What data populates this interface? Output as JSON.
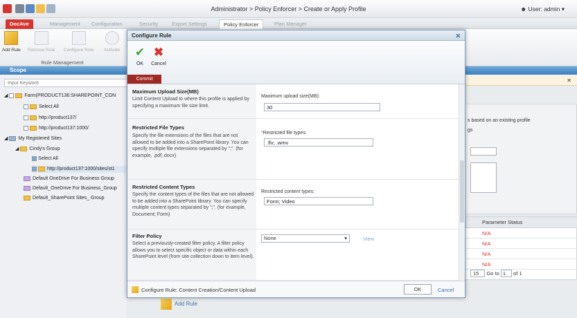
{
  "title_bar": {
    "breadcrumb": "Administrator > Policy Enforcer > Create or Apply Profile",
    "user": "User: admin"
  },
  "tabs": [
    "DocAve",
    "Management",
    "Configuration",
    "Security",
    "Export Settings",
    "Policy Enforcer",
    "Plan Manager"
  ],
  "ribbon": {
    "add_rule": "Add Rule",
    "remove_rule": "Remove Rule",
    "configure_rule": "Configure Rule",
    "activate": "Activate",
    "group": "Rule Management"
  },
  "scope": {
    "title": "Scope",
    "search_placeholder": "Input Keyword"
  },
  "tree": [
    "Farm(PRODUCT136:SHAREPOINT_CON",
    "Select All",
    "http://product137/",
    "http://product137:1000/",
    "My Registered Sites",
    "Cindy's Group",
    "Select All",
    "http://product137:1000/sites/st1",
    "Default OneDrive For Business Group",
    "Default_OneDrive For Business_Group",
    "Default_SharePoint Sites_ Group"
  ],
  "background": {
    "info_text": "s based on an existing profile",
    "info_text2": "gs",
    "col_header": "Parameter Status",
    "na_values": [
      "N/A",
      "N/A",
      "N/A",
      "N/A"
    ],
    "page_size": "15",
    "goto_label": "Go to",
    "page_value": "1",
    "of_label": "of 1",
    "add_rule": "Add Rule"
  },
  "modal": {
    "title": "Configure Rule",
    "ok_label": "OK",
    "cancel_label": "Cancel",
    "commit_label": "Commit",
    "sections": [
      {
        "title": "Maximum Upload Size(MB)",
        "desc": "Limit Content Upload to where this profile is applied by specifying a maximum file size limit.",
        "field_label": "Maximum upload size(MB):",
        "value": "30"
      },
      {
        "title": "Restricted File Types",
        "desc": "Specify the file extensions of the files that are not allowed to be added into a SharePoint library. You can specify multiple file extensions separated by \";\". (for example, .pdf;.docx)",
        "field_label": "Restricted file types:",
        "value": ".flv; .wmv"
      },
      {
        "title": "Restricted Content Types",
        "desc": "Specify the content types of the files that are not allowed to be added into a SharePoint library. You can specify multiple content types separated by \";\". (for example, Document; Form)",
        "field_label": "Restricted content types:",
        "value": "Form; Video"
      },
      {
        "title": "Filter Policy",
        "desc": "Select a previously-created filter policy. A filter policy allows you to select specific object or data within each SharePoint level (from site collection down to item level).",
        "select_value": "None",
        "view_label": "View"
      }
    ],
    "footer_path": "Configure Rule: Content Creation/Content Upload",
    "footer_ok": "OK",
    "footer_cancel": "Cancel"
  }
}
